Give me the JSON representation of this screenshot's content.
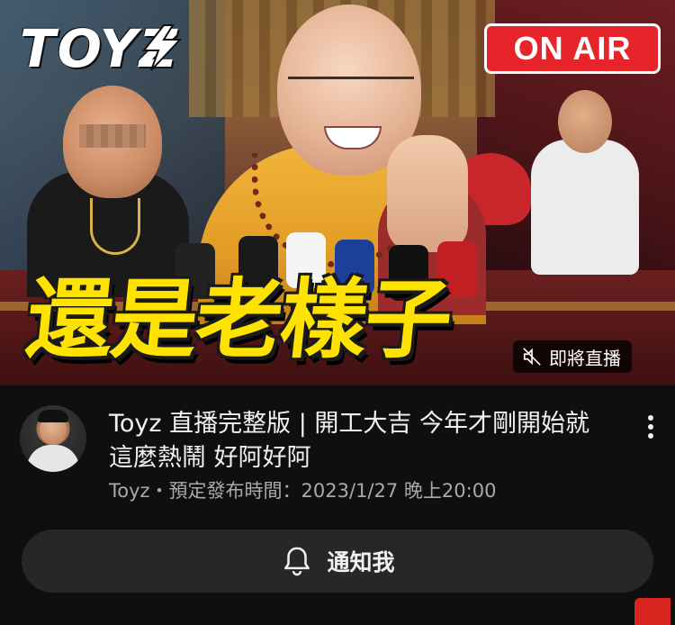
{
  "thumbnail": {
    "logo_text": "TOYZ",
    "onair_label": "ON AIR",
    "headline": "還是老樣子",
    "upcoming_badge": "即將直播",
    "colors": {
      "onair_red": "#e8242b",
      "headline_yellow": "#ffe200"
    },
    "icons": {
      "badge_icon": "sound-muted-icon"
    }
  },
  "video": {
    "title": "Toyz 直播完整版 | 開工大吉 今年才剛開始就這麼熱鬧 好阿好阿",
    "subtitle": "Toyz・預定發布時間：2023/1/27 晚上20:00",
    "more_icon": "more-vertical-icon"
  },
  "notify": {
    "label": "通知我",
    "icon": "bell-icon"
  }
}
